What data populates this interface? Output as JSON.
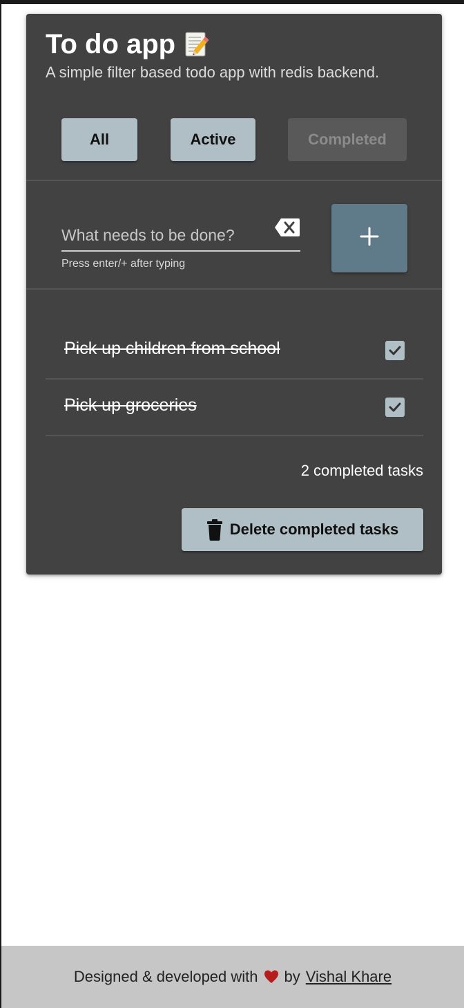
{
  "app": {
    "title": "To do app",
    "title_icon": "memo-icon",
    "subtitle": "A simple filter based todo app with redis backend."
  },
  "filters": {
    "all_label": "All",
    "active_label": "Active",
    "completed_label": "Completed",
    "selected": "Completed"
  },
  "input": {
    "placeholder": "What needs to be done?",
    "value": "",
    "helper_text": "Press enter/+ after typing",
    "clear_icon": "backspace-icon",
    "add_icon": "plus-icon"
  },
  "tasks": [
    {
      "label": "Pick up children from school",
      "completed": true
    },
    {
      "label": "Pick up groceries",
      "completed": true
    }
  ],
  "summary": {
    "count_text": "2 completed tasks",
    "delete_label": "Delete completed tasks",
    "delete_icon": "trash-icon"
  },
  "footer": {
    "prefix": "Designed & developed with",
    "heart_icon": "heart-icon",
    "by_text": "by",
    "author": "Vishal Khare"
  },
  "colors": {
    "card_bg": "#424242",
    "button_bg": "#b0bec5",
    "add_button_bg": "#5f7a89",
    "footer_bg": "#c6c6c6",
    "heart": "#b71c1c"
  }
}
